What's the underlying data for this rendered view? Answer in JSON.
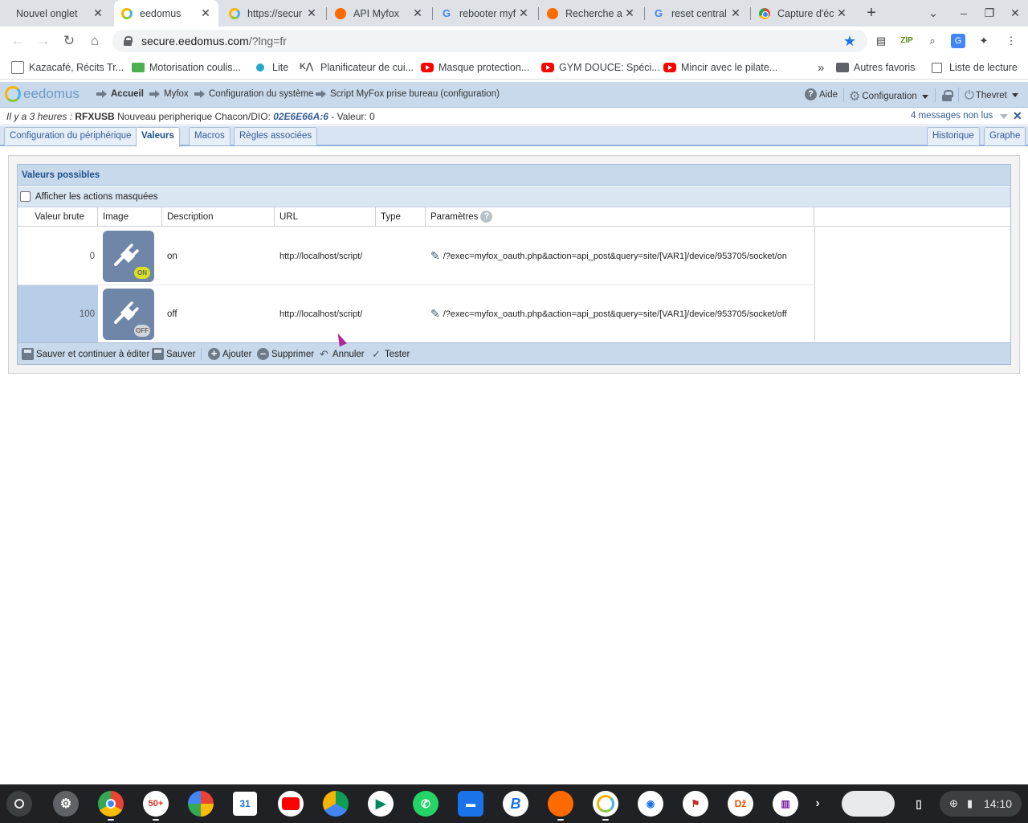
{
  "browser": {
    "tabs": [
      {
        "title": "Nouvel onglet",
        "icon": "none",
        "active": false
      },
      {
        "title": "eedomus",
        "icon": "eedomus-ring-icon",
        "active": true
      },
      {
        "title": "https://secur",
        "icon": "eedomus-ring-icon",
        "active": false
      },
      {
        "title": "API Myfox",
        "icon": "firefox-icon",
        "active": false
      },
      {
        "title": "rebooter myf",
        "icon": "google-g-icon",
        "active": false
      },
      {
        "title": "Recherche a",
        "icon": "firefox-icon",
        "active": false
      },
      {
        "title": "reset central",
        "icon": "google-g-icon",
        "active": false
      },
      {
        "title": "Capture d'éc",
        "icon": "chrome-icon",
        "active": false
      }
    ],
    "url_host": "secure.eedomus.com",
    "url_path": "/?lng=fr",
    "bookmarks": [
      {
        "label": "Kazacafé, Récits Tr...",
        "icon": "image-icon"
      },
      {
        "label": "Motorisation coulis...",
        "icon": "store-icon"
      },
      {
        "label": "Lite",
        "icon": "drop-icon"
      },
      {
        "label": "Planificateur de cui...",
        "icon": "ka-icon"
      },
      {
        "label": "Masque protection...",
        "icon": "youtube-icon"
      },
      {
        "label": "GYM DOUCE: Spéci...",
        "icon": "youtube-icon"
      },
      {
        "label": "Mincir avec le pilate...",
        "icon": "youtube-icon"
      }
    ],
    "bookmarks_more": "»",
    "other_bookmarks": "Autres favoris",
    "reading_list": "Liste de lecture"
  },
  "app": {
    "logo_text": "eedomus",
    "breadcrumbs": [
      "Accueil",
      "Myfox",
      "Configuration du système",
      "Script MyFox prise bureau (configuration)"
    ],
    "help_label": "Aide",
    "config_label": "Configuration",
    "user_label": "Thevret"
  },
  "notification": {
    "time": "Il y a 3 heures :",
    "device": "RFXUSB",
    "text": "Nouveau peripherique Chacon/DIO:",
    "address": "02E6E66A:6",
    "value_text": "- Valeur: 0",
    "unread": "4 messages non lus"
  },
  "module_tabs": {
    "left": [
      "Configuration du périphérique",
      "Valeurs",
      "Macros",
      "Règles associées"
    ],
    "right": [
      "Historique",
      "Graphe"
    ],
    "active": "Valeurs"
  },
  "panel": {
    "title": "Valeurs possibles",
    "show_hidden_label": "Afficher les actions masquées",
    "show_hidden_checked": false,
    "columns": [
      "Valeur brute",
      "Image",
      "Description",
      "URL",
      "Type",
      "Paramètres"
    ],
    "rows": [
      {
        "raw": "0",
        "badge": "ON",
        "description": "on",
        "url": "http://localhost/script/",
        "type": "",
        "params": "/?exec=myfox_oauth.php&action=api_post&query=site/[VAR1]/device/953705/socket/on",
        "selected": false
      },
      {
        "raw": "100",
        "badge": "OFF",
        "description": "off",
        "url": "http://localhost/script/",
        "type": "",
        "params": "/?exec=myfox_oauth.php&action=api_post&query=site/[VAR1]/device/953705/socket/off",
        "selected": true
      }
    ],
    "actions": [
      "Sauver et continuer à éditer",
      "Sauver",
      "Ajouter",
      "Supprimer",
      "Annuler",
      "Tester"
    ]
  },
  "shelf": {
    "time": "14:10"
  }
}
